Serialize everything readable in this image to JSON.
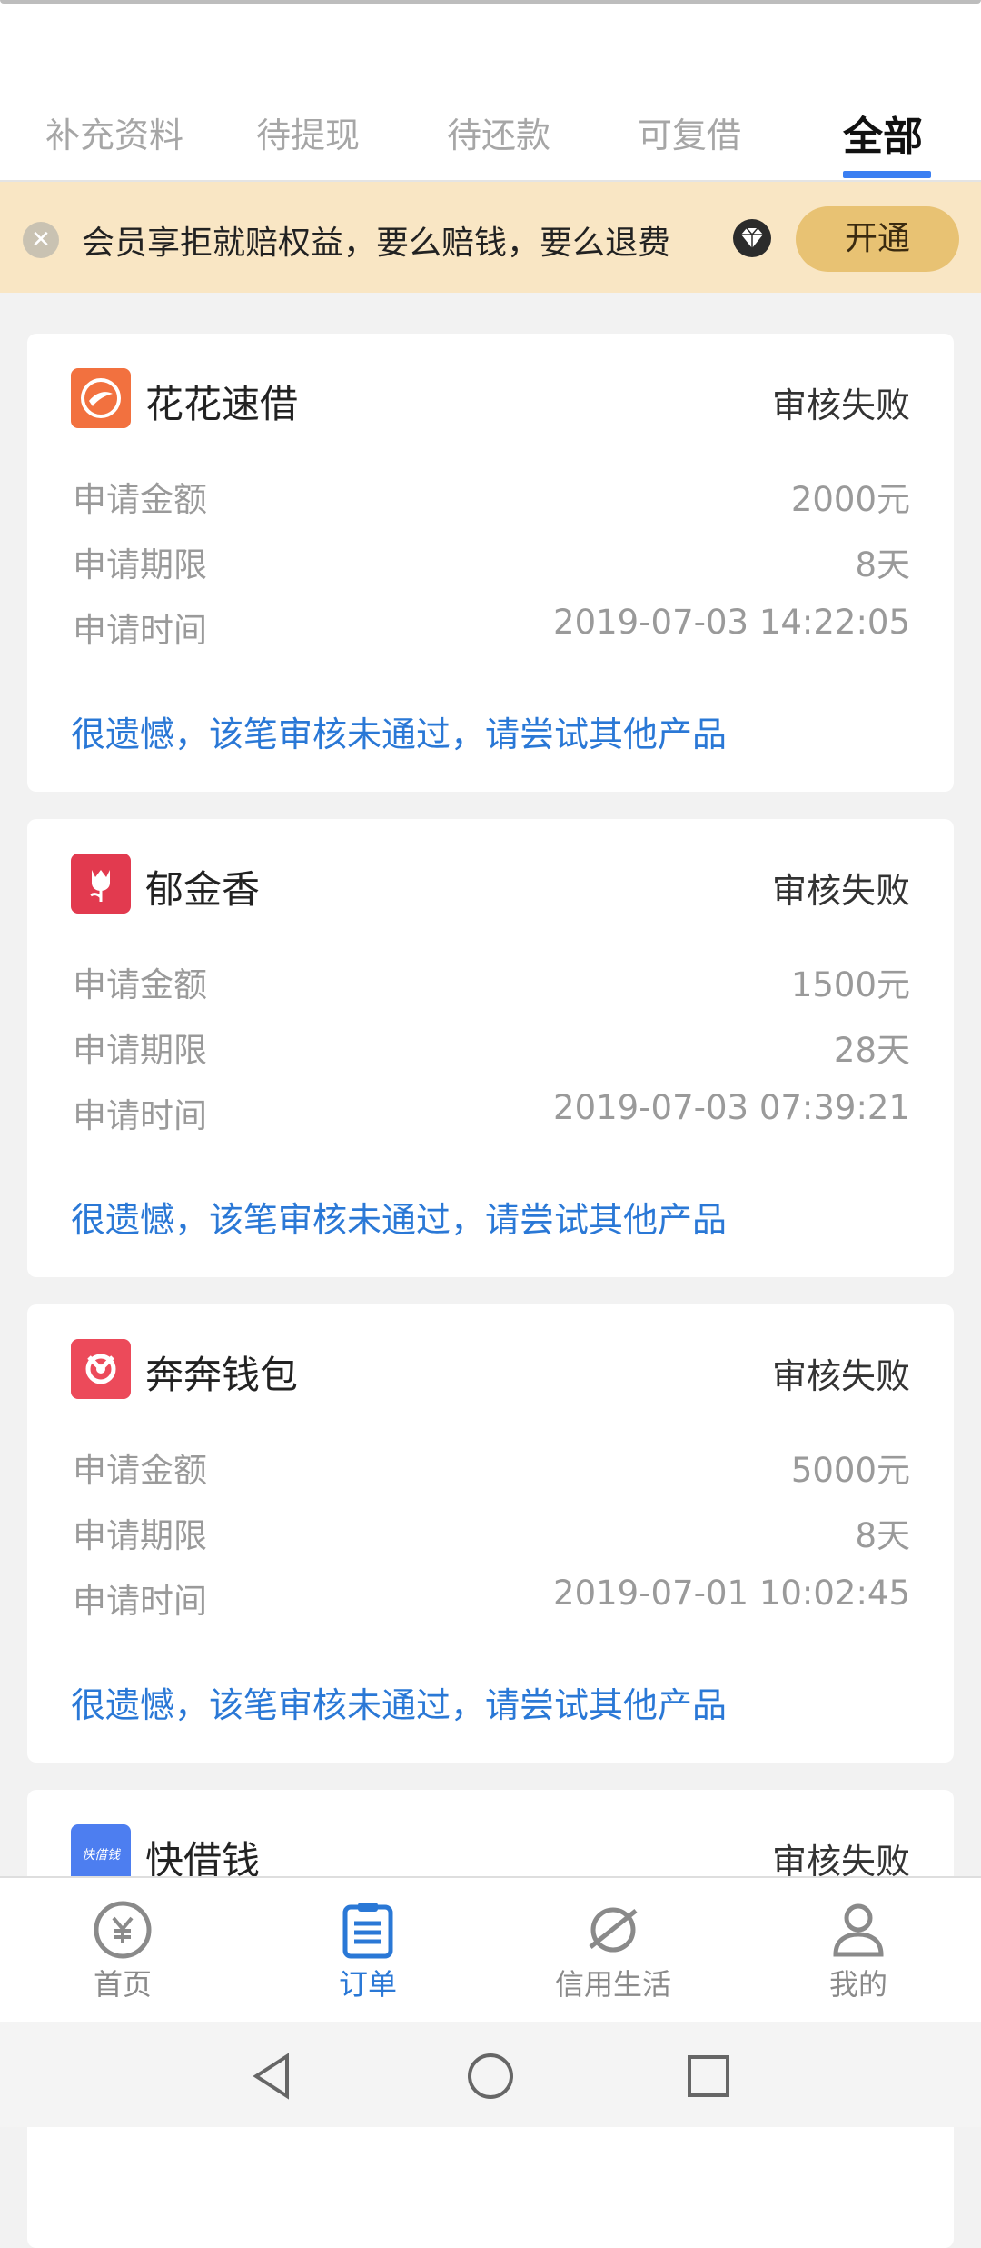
{
  "tabs": [
    {
      "label": "补充资料",
      "active": false
    },
    {
      "label": "待提现",
      "active": false
    },
    {
      "label": "待还款",
      "active": false
    },
    {
      "label": "可复借",
      "active": false
    },
    {
      "label": "全部",
      "active": true
    }
  ],
  "banner": {
    "close_icon": "close-icon",
    "text": "会员享拒就赔权益，要么赔钱，要么退费",
    "badge_icon": "diamond-icon",
    "button_label": "开通"
  },
  "orders": [
    {
      "name": "花花速借",
      "icon": "huahua-logo",
      "icon_color": "#f2713f",
      "status": "审核失败",
      "rows": [
        {
          "label": "申请金额",
          "value": "2000元"
        },
        {
          "label": "申请期限",
          "value": "8天"
        },
        {
          "label": "申请时间",
          "value": "2019-07-03 14:22:05"
        }
      ],
      "message": "很遗憾，该笔审核未通过，请尝试其他产品"
    },
    {
      "name": "郁金香",
      "icon": "tulip-logo",
      "icon_color": "#e23a4f",
      "status": "审核失败",
      "rows": [
        {
          "label": "申请金额",
          "value": "1500元"
        },
        {
          "label": "申请期限",
          "value": "28天"
        },
        {
          "label": "申请时间",
          "value": "2019-07-03 07:39:21"
        }
      ],
      "message": "很遗憾，该笔审核未通过，请尝试其他产品"
    },
    {
      "name": "奔奔钱包",
      "icon": "benben-logo",
      "icon_color": "#ec4a5a",
      "status": "审核失败",
      "rows": [
        {
          "label": "申请金额",
          "value": "5000元"
        },
        {
          "label": "申请期限",
          "value": "8天"
        },
        {
          "label": "申请时间",
          "value": "2019-07-01 10:02:45"
        }
      ],
      "message": "很遗憾，该笔审核未通过，请尝试其他产品"
    },
    {
      "name": "快借钱",
      "icon": "kuaijieqian-logo",
      "icon_color": "#4d7ef0",
      "icon_text": "快借钱",
      "status": "审核失败"
    }
  ],
  "bottom_nav": [
    {
      "label": "首页",
      "icon": "yen-icon",
      "active": false
    },
    {
      "label": "订单",
      "icon": "clipboard-icon",
      "active": true
    },
    {
      "label": "信用生活",
      "icon": "planet-icon",
      "active": false
    },
    {
      "label": "我的",
      "icon": "user-icon",
      "active": false
    }
  ],
  "system_nav": [
    "back-icon",
    "home-icon",
    "recent-apps-icon"
  ],
  "colors": {
    "accent_blue": "#2a78d6",
    "tab_underline": "#3b7ff2",
    "banner_bg": "#f9e6c4",
    "banner_button": "#e8c273"
  }
}
